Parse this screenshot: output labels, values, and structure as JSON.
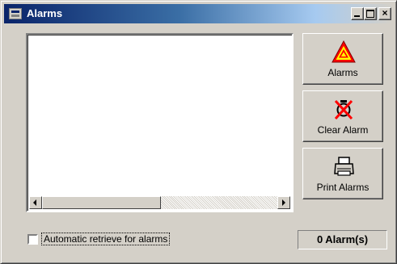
{
  "window": {
    "title": "Alarms",
    "close_glyph": "×"
  },
  "buttons": {
    "alarms": {
      "label": "Alarms",
      "icon": "warning-triangle-icon",
      "icon_colors": [
        "#ff0000",
        "#ffff00"
      ]
    },
    "clear_alarm": {
      "label": "Clear Alarm",
      "icon": "clear-alarm-icon",
      "icon_colors": [
        "#ff0000",
        "#000000"
      ]
    },
    "print_alarms": {
      "label": "Print Alarms",
      "icon": "printer-icon"
    }
  },
  "auto_retrieve": {
    "label": "Automatic retrieve for alarms",
    "checked": false
  },
  "status": {
    "alarm_count": "0 Alarm(s)"
  },
  "alarm_list": {
    "items": []
  }
}
